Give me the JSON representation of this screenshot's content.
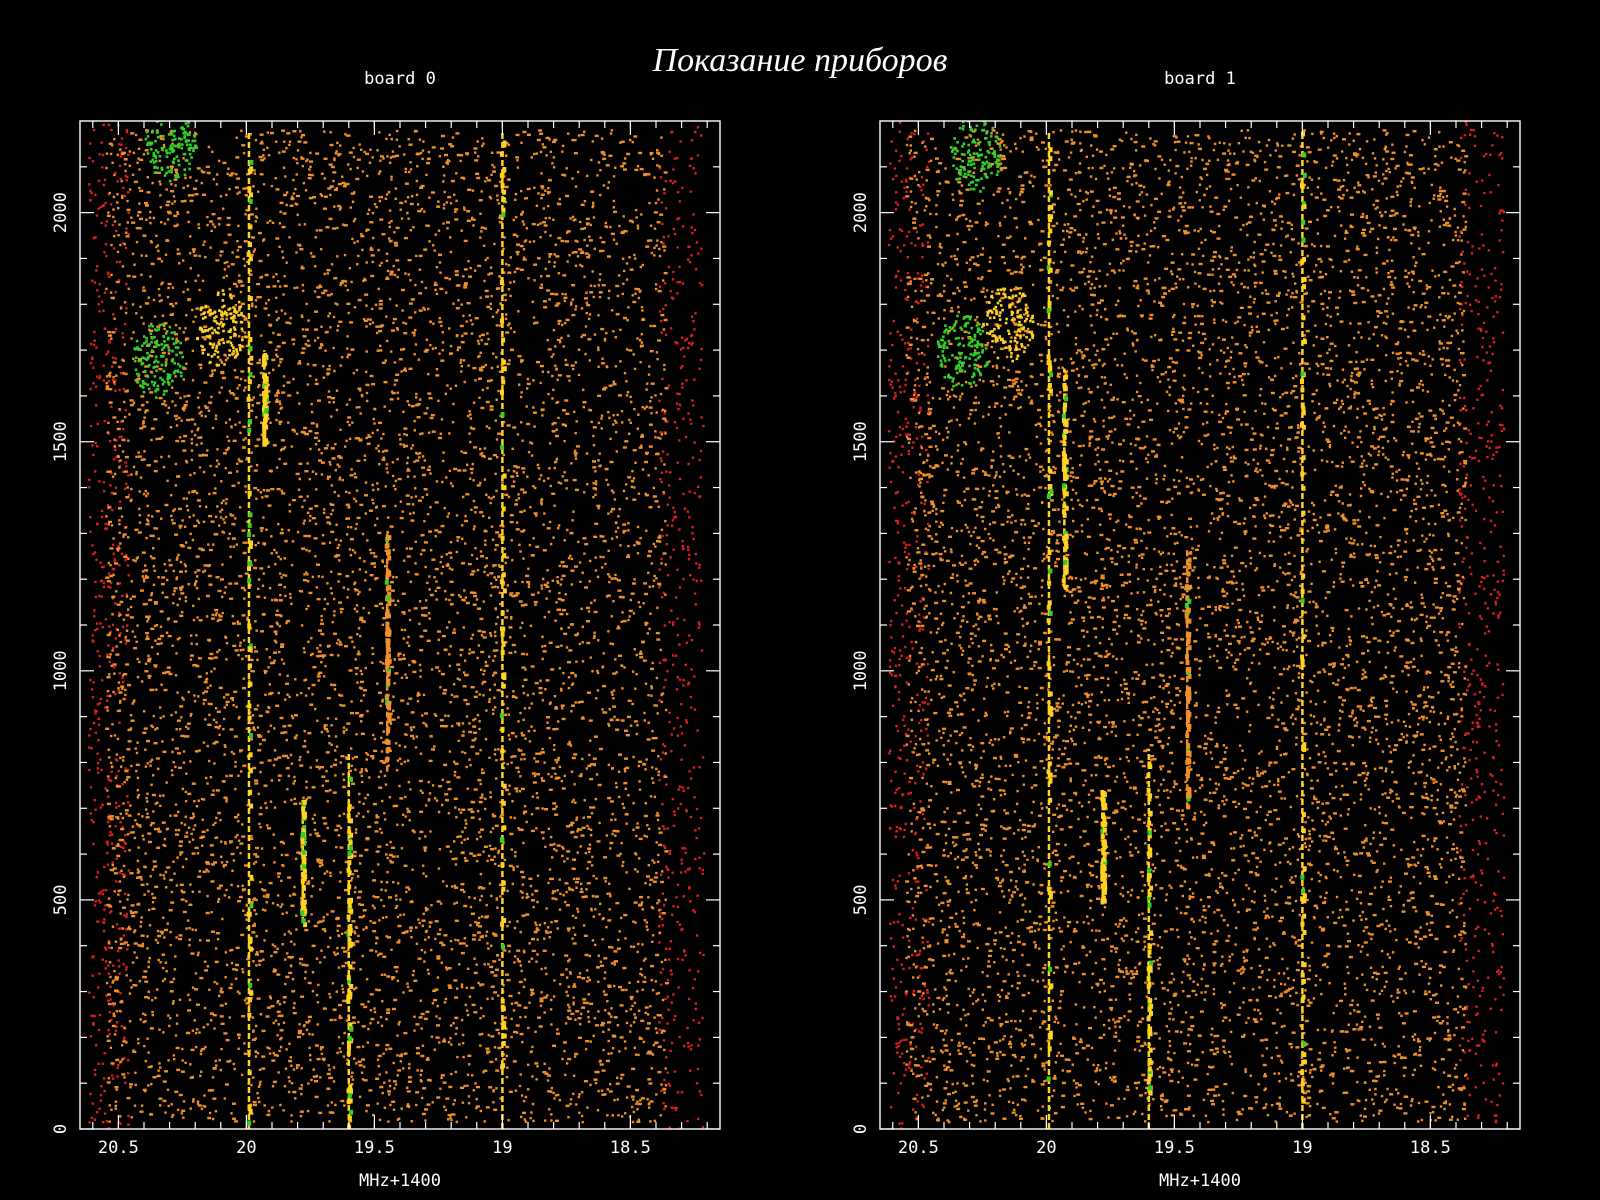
{
  "slide": {
    "title": "Показание приборов"
  },
  "colors": {
    "background": "#000000",
    "axes": "#ffffff",
    "dots": "#f0902a",
    "edge": "#d8201e",
    "line": "#ffd320",
    "green": "#2fd12a"
  },
  "chart_data": [
    {
      "type": "scatter",
      "title": "board 0",
      "xlabel": "MHz+1400",
      "ylabel": "",
      "xlim": [
        20.65,
        18.15
      ],
      "ylim": [
        0,
        2200
      ],
      "x_ticks": [
        "20.5",
        "20",
        "19.5",
        "19",
        "18.5"
      ],
      "x_tick_values": [
        20.5,
        20,
        19.5,
        19,
        18.5
      ],
      "y_ticks": [
        "0",
        "500",
        "1000",
        "1500",
        "2000"
      ],
      "y_tick_values": [
        0,
        500,
        1000,
        1500,
        2000
      ],
      "lines": [
        {
          "x": 19.99,
          "y": [
            0,
            2180
          ],
          "color": "yellow"
        },
        {
          "x": 19.0,
          "y": [
            0,
            2180
          ],
          "color": "yellow"
        },
        {
          "x": 19.78,
          "y": [
            450,
            720
          ],
          "color": "yellow"
        },
        {
          "x": 19.6,
          "y": [
            0,
            820
          ],
          "color": "yellow"
        },
        {
          "x": 19.45,
          "y": [
            780,
            1300
          ],
          "color": "orange"
        },
        {
          "x": 19.93,
          "y": [
            1500,
            1700
          ],
          "color": "yellow"
        }
      ],
      "clusters": [
        {
          "x": 20.35,
          "y": 1680,
          "color": "green"
        },
        {
          "x": 20.3,
          "y": 2150,
          "color": "green"
        },
        {
          "x": 20.1,
          "y": 1750,
          "color": "yellow"
        }
      ]
    },
    {
      "type": "scatter",
      "title": "board 1",
      "xlabel": "MHz+1400",
      "ylabel": "",
      "xlim": [
        20.65,
        18.15
      ],
      "ylim": [
        0,
        2200
      ],
      "x_ticks": [
        "20.5",
        "20",
        "19.5",
        "19",
        "18.5"
      ],
      "x_tick_values": [
        20.5,
        20,
        19.5,
        19,
        18.5
      ],
      "y_ticks": [
        "0",
        "500",
        "1000",
        "1500",
        "2000"
      ],
      "y_tick_values": [
        0,
        500,
        1000,
        1500,
        2000
      ],
      "lines": [
        {
          "x": 19.99,
          "y": [
            0,
            2180
          ],
          "color": "yellow"
        },
        {
          "x": 19.0,
          "y": [
            0,
            2180
          ],
          "color": "yellow"
        },
        {
          "x": 19.78,
          "y": [
            500,
            740
          ],
          "color": "yellow"
        },
        {
          "x": 19.6,
          "y": [
            0,
            830
          ],
          "color": "yellow"
        },
        {
          "x": 19.45,
          "y": [
            700,
            1270
          ],
          "color": "orange"
        },
        {
          "x": 19.93,
          "y": [
            1180,
            1660
          ],
          "color": "yellow"
        }
      ],
      "clusters": [
        {
          "x": 20.33,
          "y": 1700,
          "color": "green"
        },
        {
          "x": 20.28,
          "y": 2130,
          "color": "green"
        },
        {
          "x": 20.15,
          "y": 1760,
          "color": "yellow"
        }
      ]
    }
  ]
}
